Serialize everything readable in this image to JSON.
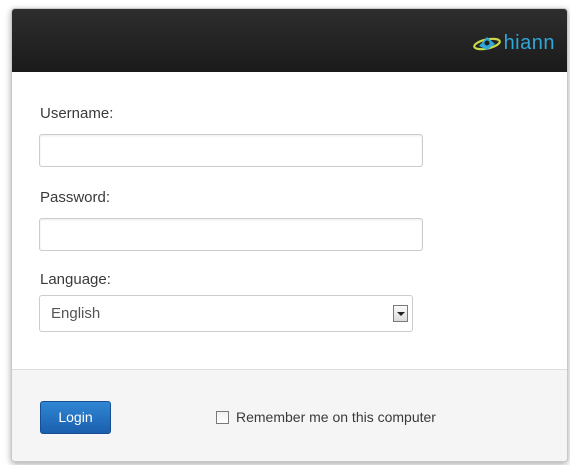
{
  "header": {
    "logo_text": "hiann",
    "logo_icon": "hiann-logo-icon"
  },
  "form": {
    "username": {
      "label": "Username:",
      "value": "",
      "placeholder": ""
    },
    "password": {
      "label": "Password:",
      "value": "",
      "placeholder": ""
    },
    "language": {
      "label": "Language:",
      "selected": "English",
      "arrow_icon": "dropdown-arrow-icon"
    }
  },
  "footer": {
    "login_label": "Login",
    "remember_label": "Remember me on this computer",
    "remember_checked": false
  },
  "colors": {
    "header_bg": "#1f1f1f",
    "logo_accent": "#2fa7d8",
    "login_button": "#1f6fbf",
    "footer_bg": "#f5f5f5"
  }
}
